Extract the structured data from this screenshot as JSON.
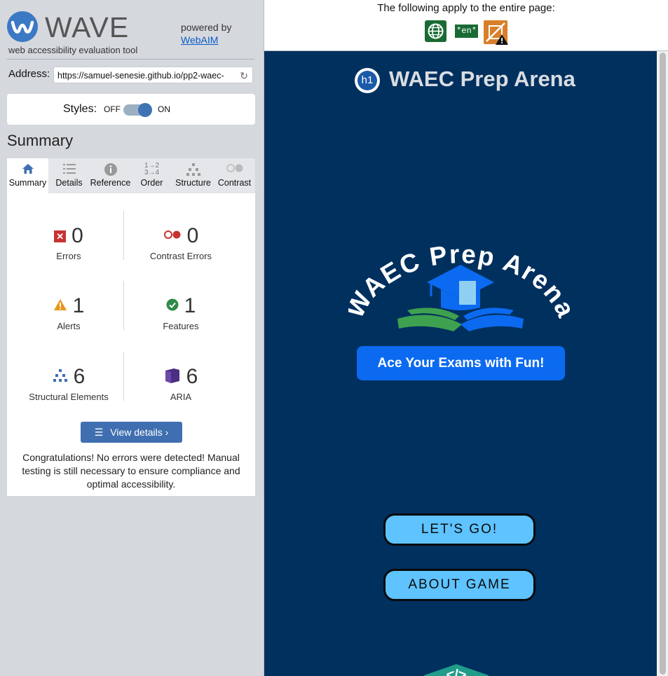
{
  "wave": {
    "logo_text": "WAVE",
    "subtitle": "web accessibility evaluation tool",
    "powered_by": "powered by",
    "webaim_link": "WebAIM",
    "address_label": "Address:",
    "address_value": "https://samuel-senesie.github.io/pp2-waec-",
    "styles_label": "Styles:",
    "styles_off": "OFF",
    "styles_on": "ON",
    "summary_heading": "Summary",
    "tabs": [
      {
        "label": "Summary",
        "icon": "home-icon"
      },
      {
        "label": "Details",
        "icon": "list-icon"
      },
      {
        "label": "Reference",
        "icon": "info-icon"
      },
      {
        "label": "Order",
        "icon": "order-icon"
      },
      {
        "label": "Structure",
        "icon": "structure-icon"
      },
      {
        "label": "Contrast",
        "icon": "contrast-icon"
      }
    ],
    "stats": {
      "errors": {
        "value": "0",
        "label": "Errors"
      },
      "contrast_errors": {
        "value": "0",
        "label": "Contrast Errors"
      },
      "alerts": {
        "value": "1",
        "label": "Alerts"
      },
      "features": {
        "value": "1",
        "label": "Features"
      },
      "structural": {
        "value": "6",
        "label": "Structural Elements"
      },
      "aria": {
        "value": "6",
        "label": "ARIA"
      }
    },
    "view_details": "View details ›",
    "congrats": "Congratulations! No errors were detected! Manual testing is still necessary to ensure compliance and optimal accessibility."
  },
  "topbar": {
    "text": "The following apply to the entire page:",
    "lang_badge": "*en*"
  },
  "site": {
    "h1_badge": "h1",
    "title": "WAEC Prep Arena",
    "logo_arc_text": "WAEC Prep Arena",
    "tagline": "Ace Your Exams with  Fun!",
    "btn_go": "LET'S GO!",
    "btn_about": "ABOUT GAME",
    "code_badge": "</>"
  },
  "colors": {
    "site_bg": "#00305e",
    "button_bg": "#5ec3ff",
    "tagline_bg": "#0b6af0",
    "wave_accent": "#3d6fb1"
  }
}
